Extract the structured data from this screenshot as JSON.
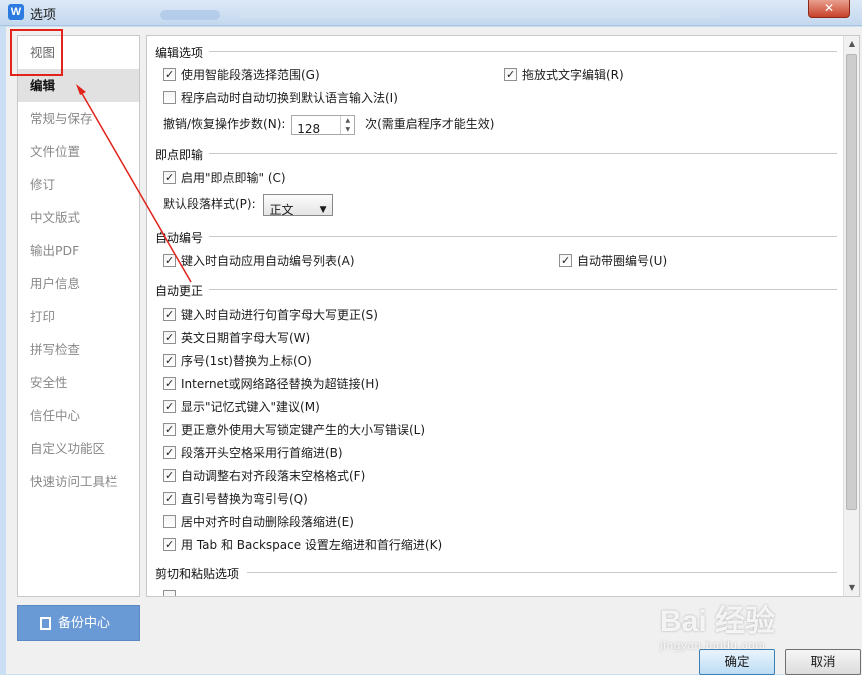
{
  "window": {
    "title": "选项",
    "close_label": "✕"
  },
  "sidebar": {
    "items": [
      {
        "label": "视图"
      },
      {
        "label": "编辑"
      },
      {
        "label": "常规与保存"
      },
      {
        "label": "文件位置"
      },
      {
        "label": "修订"
      },
      {
        "label": "中文版式"
      },
      {
        "label": "输出PDF"
      },
      {
        "label": "用户信息"
      },
      {
        "label": "打印"
      },
      {
        "label": "拼写检查"
      },
      {
        "label": "安全性"
      },
      {
        "label": "信任中心"
      },
      {
        "label": "自定义功能区"
      },
      {
        "label": "快速访问工具栏"
      }
    ],
    "active_index": 1,
    "backup_label": "备份中心"
  },
  "sections": {
    "edit": {
      "title": "编辑选项",
      "smart_para": {
        "label": "使用智能段落选择范围(G)",
        "checked": true
      },
      "drag_text": {
        "label": "拖放式文字编辑(R)",
        "checked": true
      },
      "auto_ime": {
        "label": "程序启动时自动切换到默认语言输入法(I)",
        "checked": false
      },
      "undo_label": "撤销/恢复操作步数(N):",
      "undo_value": "128",
      "undo_suffix": "次(需重启程序才能生效)"
    },
    "click_type": {
      "title": "即点即输",
      "enable": {
        "label": "启用\"即点即输\" (C)",
        "checked": true
      },
      "style_label": "默认段落样式(P):",
      "style_value": "正文"
    },
    "autonumber": {
      "title": "自动编号",
      "apply_list": {
        "label": "键入时自动应用自动编号列表(A)",
        "checked": true
      },
      "circled": {
        "label": "自动带圈编号(U)",
        "checked": true
      }
    },
    "autocorrect": {
      "title": "自动更正",
      "items": [
        {
          "label": "键入时自动进行句首字母大写更正(S)",
          "checked": true
        },
        {
          "label": "英文日期首字母大写(W)",
          "checked": true
        },
        {
          "label": "序号(1st)替换为上标(O)",
          "checked": true
        },
        {
          "label": "Internet或网络路径替换为超链接(H)",
          "checked": true
        },
        {
          "label": "显示\"记忆式键入\"建议(M)",
          "checked": true
        },
        {
          "label": "更正意外使用大写锁定键产生的大小写错误(L)",
          "checked": true
        },
        {
          "label": "段落开头空格采用行首缩进(B)",
          "checked": true
        },
        {
          "label": "自动调整右对齐段落末空格格式(F)",
          "checked": true
        },
        {
          "label": "直引号替换为弯引号(Q)",
          "checked": true
        },
        {
          "label": "居中对齐时自动删除段落缩进(E)",
          "checked": false
        },
        {
          "label": "用 Tab 和 Backspace 设置左缩进和首行缩进(K)",
          "checked": true
        }
      ]
    },
    "paste": {
      "title": "剪切和粘贴选项"
    }
  },
  "footer": {
    "ok_label": "确定",
    "cancel_label": "取消"
  },
  "watermark": {
    "big": "Bai 经验",
    "small": "jingyan.baidu.com"
  },
  "colors": {
    "annotation_red": "#e0231b",
    "backup_blue": "#6a9ad6"
  }
}
